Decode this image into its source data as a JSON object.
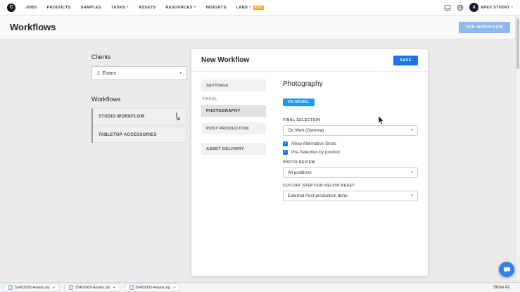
{
  "icons": {
    "chevron_down": "▾",
    "check": "✓"
  },
  "colors": {
    "accent_blue": "#1a73e8",
    "badge_blue": "#2196f3",
    "beta_orange": "#f5a623",
    "fab_blue": "#2f80ed"
  },
  "nav": {
    "logo_letter": "C",
    "items": [
      {
        "label": "JOBS"
      },
      {
        "label": "PRODUCTS"
      },
      {
        "label": "SAMPLES"
      },
      {
        "label": "TASKS",
        "has_dropdown": true
      },
      {
        "label": "ASSETS"
      },
      {
        "label": "RESOURCES",
        "has_dropdown": true
      },
      {
        "label": "INSIGHTS"
      },
      {
        "label": "LABS",
        "has_dropdown": true,
        "badge": "BETA"
      }
    ],
    "account_name": "APEX STUDIO",
    "avatar_letter": "A"
  },
  "header": {
    "title": "Workflows",
    "add_button_label": "ADD WORKFLOW"
  },
  "sidebar": {
    "clients_title": "Clients",
    "selected_client": "J. Evans",
    "workflows_title": "Workflows",
    "workflows": [
      {
        "label": "STUDIO WORKFLOW",
        "locked": true
      },
      {
        "label": "TABLETOP ACCESSORIES",
        "locked": false
      }
    ]
  },
  "editor": {
    "title": "New Workflow",
    "save_button_label": "SAVE",
    "settings_tab_label": "SETTINGS",
    "visual_group_label": "VISUAL",
    "visual_tabs": [
      {
        "label": "PHOTOGRAPHY",
        "active": true
      },
      {
        "label": "POST PRODUCTION",
        "active": false
      },
      {
        "label": "ASSET DELIVERY",
        "active": false
      }
    ],
    "panel": {
      "title": "Photography",
      "type_badge": "ON MODEL",
      "final_selection_label": "FINAL SELECTION",
      "final_selection_value": "On Web (Gamma)",
      "checkboxes": [
        {
          "label": "Allow Alternative Shots",
          "checked": true
        },
        {
          "label": "Pre-Selection by position",
          "checked": true
        }
      ],
      "photo_review_label": "PHOTO REVIEW",
      "photo_review_value": "All positions",
      "cutoff_label": "CUT-OFF STEP FOR KELVIN RESET",
      "cutoff_value": "External Post-production done"
    }
  },
  "downloads_bar": {
    "items": [
      {
        "label": "55453005-Assets.zip"
      },
      {
        "label": "55453005-Assets.zip"
      },
      {
        "label": "55453005-Assets.zip"
      }
    ],
    "show_all_label": "Show All"
  }
}
